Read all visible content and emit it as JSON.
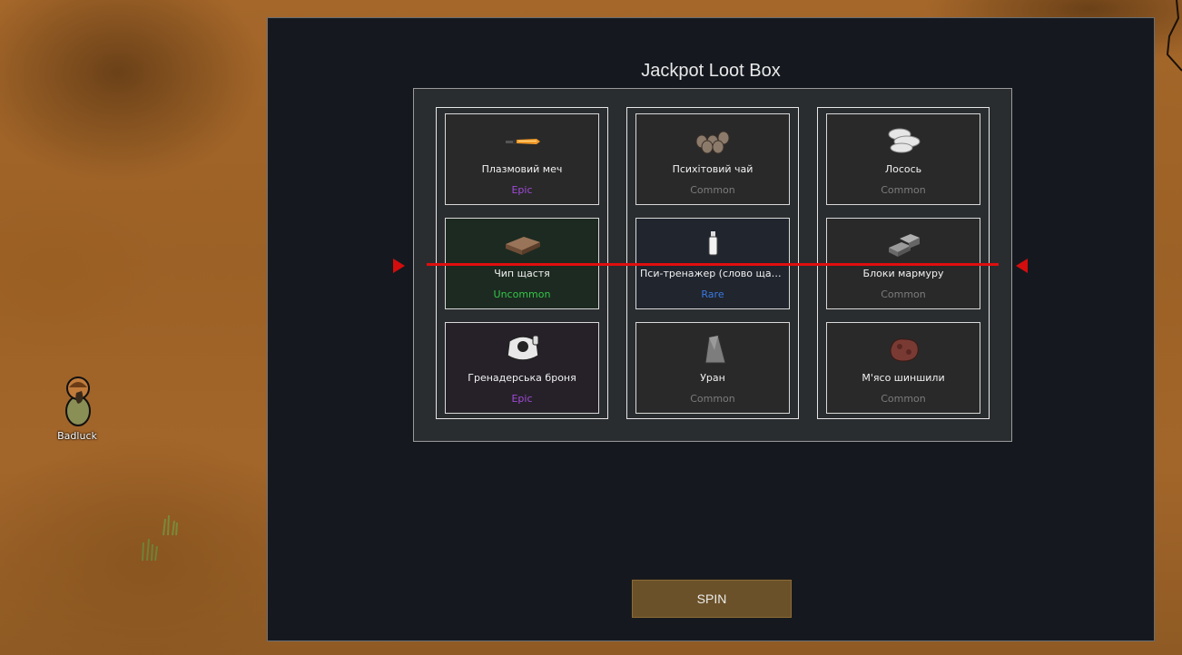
{
  "window": {
    "title": "Jackpot Loot Box"
  },
  "pawn": {
    "name": "Badluck"
  },
  "reels": [
    [
      {
        "name": "Плазмовий меч",
        "rarity": "Epic",
        "rarity_class": "epic",
        "icon": "plasma-sword-icon"
      },
      {
        "name": "Чип щастя",
        "rarity": "Uncommon",
        "rarity_class": "uncommon",
        "icon": "luck-chip-icon"
      },
      {
        "name": "Гренадерська броня",
        "rarity": "Epic",
        "rarity_class": "epic",
        "icon": "grenadier-armor-icon"
      }
    ],
    [
      {
        "name": "Психітовий чай",
        "rarity": "Common",
        "rarity_class": "common",
        "icon": "psychite-tea-icon"
      },
      {
        "name": "Пси-тренажер (слово щастя)",
        "rarity": "Rare",
        "rarity_class": "rare",
        "icon": "psytrainer-icon"
      },
      {
        "name": "Уран",
        "rarity": "Common",
        "rarity_class": "common",
        "icon": "uranium-icon"
      }
    ],
    [
      {
        "name": "Лосось",
        "rarity": "Common",
        "rarity_class": "common",
        "icon": "salmon-icon"
      },
      {
        "name": "Блоки мармуру",
        "rarity": "Common",
        "rarity_class": "common",
        "icon": "marble-blocks-icon"
      },
      {
        "name": "М'ясо шиншили",
        "rarity": "Common",
        "rarity_class": "common",
        "icon": "chinchilla-meat-icon"
      }
    ]
  ],
  "buttons": {
    "spin_label": "SPIN"
  },
  "colors": {
    "epic": "#a14ad8",
    "uncommon": "#33c749",
    "rare": "#3b78e0",
    "common": "#7c7c7c",
    "payline": "#e00e0e",
    "spin_button": "#6b5129"
  }
}
